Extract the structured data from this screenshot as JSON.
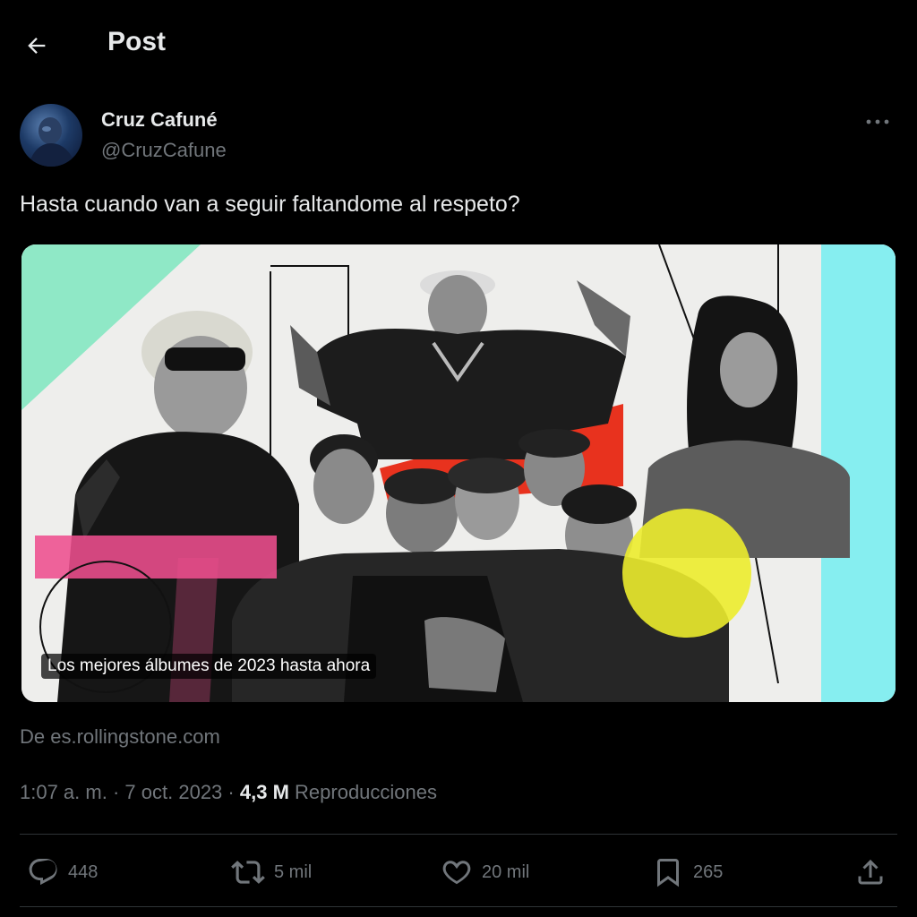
{
  "header": {
    "title": "Post"
  },
  "author": {
    "name": "Cruz Cafuné",
    "handle": "@CruzCafune"
  },
  "post": {
    "text": "Hasta cuando van a seguir faltandome al respeto?",
    "card_caption": "Los mejores álbumes de 2023 hasta ahora",
    "source": "De es.rollingstone.com"
  },
  "meta": {
    "time": "1:07 a. m.",
    "separator": "·",
    "date": "7 oct. 2023",
    "views": "4,3 M",
    "views_label": "Reproducciones"
  },
  "actions": {
    "replies": "448",
    "reposts": "5 mil",
    "likes": "20 mil",
    "bookmarks": "265"
  },
  "icons": [
    "back-arrow-icon",
    "more-icon",
    "reply-icon",
    "repost-icon",
    "like-icon",
    "bookmark-icon",
    "share-icon"
  ],
  "colors": {
    "background": "#000000",
    "text": "#e7e9ea",
    "secondary_text": "#71767b",
    "divider": "#2f3336",
    "card_mint": "#8fe8c6",
    "card_cyan": "#86eef0",
    "card_pink": "#ee4f8e",
    "card_red": "#e8321e",
    "card_purple": "#8a5cf0",
    "card_yellow": "#ecec2e"
  }
}
